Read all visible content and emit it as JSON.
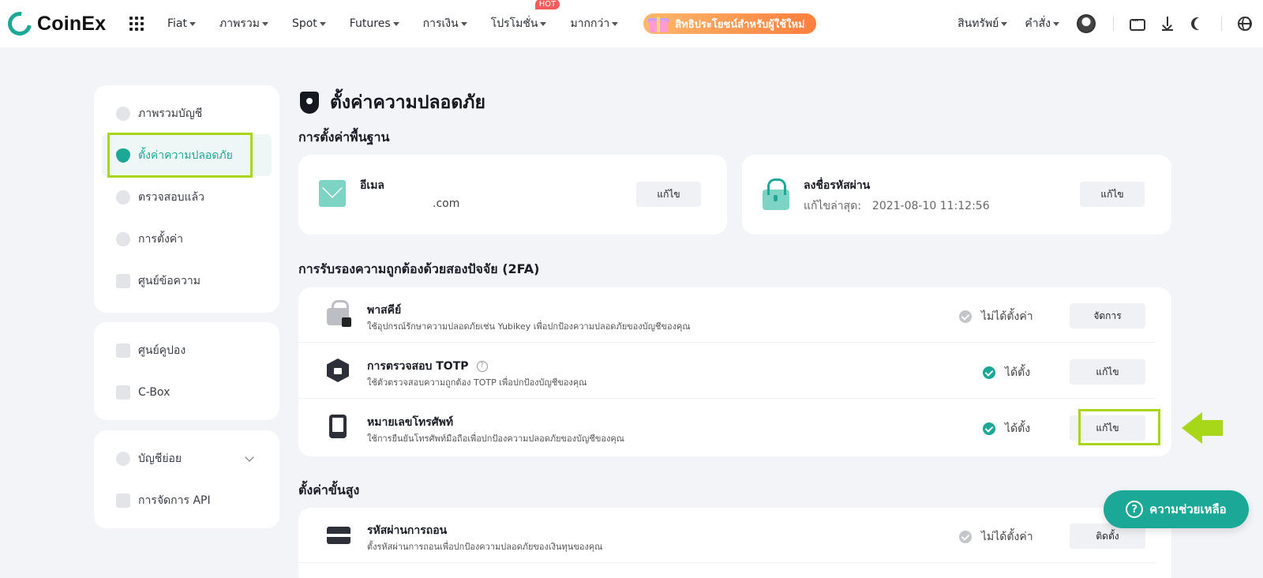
{
  "brand": {
    "name": "CoinEx"
  },
  "nav": {
    "items": [
      "Fiat",
      "ภาพรวม",
      "Spot",
      "Futures",
      "การเงิน",
      "โปรโมชั่น",
      "มากกว่า"
    ],
    "hot_badge": "HOT",
    "promo": "สิทธิประโยชน์สำหรับผู้ใช้ใหม่",
    "right_items": [
      "สินทรัพย์",
      "คำสั่ง"
    ]
  },
  "sidebar": {
    "group1": [
      "ภาพรวมบัญชี",
      "ตั้งค่าความปลอดภัย",
      "ตรวจสอบแล้ว",
      "การตั้งค่า",
      "ศูนย์ข้อความ"
    ],
    "group2": [
      "ศูนย์คูปอง",
      "C-Box"
    ],
    "group3": [
      "บัญชีย่อย",
      "การจัดการ API"
    ]
  },
  "page": {
    "title": "ตั้งค่าความปลอดภัย",
    "basic_section": "การตั้งค่าพื้นฐาน",
    "email": {
      "label": "อีเมล",
      "value": ".com",
      "button": "แก้ไข"
    },
    "password": {
      "label": "ลงชื่อรหัสผ่าน",
      "last_modified_label": "แก้ไขล่าสุด:",
      "last_modified": "2021-08-10 11:12:56",
      "button": "แก้ไข"
    },
    "twofa_section": "การรับรองความถูกต้องด้วยสองปัจจัย (2FA)",
    "twofa": [
      {
        "title": "พาสคีย์",
        "desc": "ใช้อุปกรณ์รักษาความปลอดภัยเช่น Yubikey เพื่อปกป้องความปลอดภัยของบัญชีของคุณ",
        "status": "ไม่ได้ตั้งค่า",
        "button": "จัดการ"
      },
      {
        "title": "การตรวจสอบ TOTP",
        "desc": "ใช้ตัวตรวจสอบความถูกต้อง TOTP เพื่อปกป้องบัญชีของคุณ",
        "status": "ได้ตั้ง",
        "button": "แก้ไข"
      },
      {
        "title": "หมายเลขโทรศัพท์",
        "desc": "ใช้การยืนยันโทรศัพท์มือถือเพื่อปกป้องความปลอดภัยของบัญชีของคุณ",
        "status": "ได้ตั้ง",
        "button": "แก้ไข"
      }
    ],
    "advanced_section": "ตั้งค่าขั้นสูง",
    "withdraw": {
      "title": "รหัสผ่านการถอน",
      "desc": "ตั้งรหัสผ่านการถอนเพื่อปกป้องความปลอดภัยของเงินทุนของคุณ",
      "status": "ไม่ได้ตั้งค่า",
      "button": "ติดตั้ง"
    }
  },
  "help_button": {
    "icon": "?",
    "label": "ความช่วยเหลือ"
  },
  "colors": {
    "accent": "#1ca896",
    "highlight": "#a8d619"
  }
}
